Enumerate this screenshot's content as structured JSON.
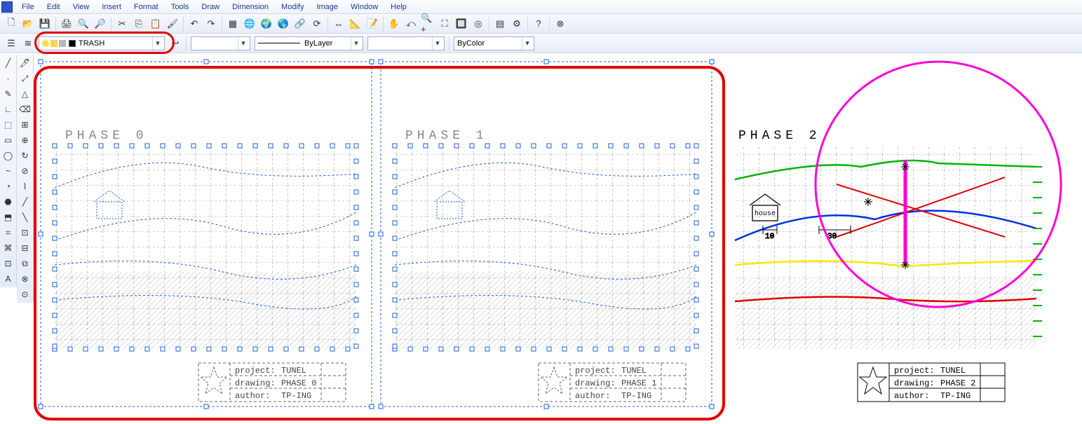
{
  "menubar": {
    "items": [
      "File",
      "Edit",
      "View",
      "Insert",
      "Format",
      "Tools",
      "Draw",
      "Dimension",
      "Modify",
      "Image",
      "Window",
      "Help"
    ]
  },
  "toolbar1": {
    "buttons": [
      {
        "name": "new-icon",
        "glyph": "🗋"
      },
      {
        "name": "open-icon",
        "glyph": "📂"
      },
      {
        "name": "save-icon",
        "glyph": "💾"
      },
      {
        "name": "sep"
      },
      {
        "name": "print-icon",
        "glyph": "🖨"
      },
      {
        "name": "print-preview-icon",
        "glyph": "🔍"
      },
      {
        "name": "find-icon",
        "glyph": "🔎"
      },
      {
        "name": "sep"
      },
      {
        "name": "cut-icon",
        "glyph": "✂"
      },
      {
        "name": "copy-icon",
        "glyph": "⎘"
      },
      {
        "name": "paste-icon",
        "glyph": "📋"
      },
      {
        "name": "match-props-icon",
        "glyph": "🖌"
      },
      {
        "name": "sep"
      },
      {
        "name": "undo-icon",
        "glyph": "↶"
      },
      {
        "name": "redo-icon",
        "glyph": "↷"
      },
      {
        "name": "sep"
      },
      {
        "name": "grid-icon",
        "glyph": "▦"
      },
      {
        "name": "web-icon",
        "glyph": "🌐"
      },
      {
        "name": "world-icon",
        "glyph": "🌍"
      },
      {
        "name": "globe2-icon",
        "glyph": "🌎"
      },
      {
        "name": "link-icon",
        "glyph": "🔗"
      },
      {
        "name": "refresh-icon",
        "glyph": "⟳"
      },
      {
        "name": "sep"
      },
      {
        "name": "dim-icon",
        "glyph": "↔"
      },
      {
        "name": "measure-icon",
        "glyph": "📐"
      },
      {
        "name": "note-icon",
        "glyph": "📝"
      },
      {
        "name": "sep"
      },
      {
        "name": "pan-icon",
        "glyph": "✋"
      },
      {
        "name": "zoom-prev-icon",
        "glyph": "⤺"
      },
      {
        "name": "zoom-in-icon",
        "glyph": "🔍+"
      },
      {
        "name": "zoom-ext-icon",
        "glyph": "⛶"
      },
      {
        "name": "zoom-win-icon",
        "glyph": "🔲"
      },
      {
        "name": "zoom-all-icon",
        "glyph": "◎"
      },
      {
        "name": "sep"
      },
      {
        "name": "table-icon",
        "glyph": "▤"
      },
      {
        "name": "props-icon",
        "glyph": "⚙"
      },
      {
        "name": "sep"
      },
      {
        "name": "help-icon",
        "glyph": "?"
      },
      {
        "name": "sep"
      },
      {
        "name": "close-icon",
        "glyph": "⊗"
      }
    ]
  },
  "toolbar2": {
    "layer_combo": {
      "value": "TRASH"
    },
    "color_combo": {
      "value": ""
    },
    "linetype_combo": {
      "value": "ByLayer"
    },
    "lineweight_combo": {
      "value": ""
    },
    "plotstyle_combo": {
      "value": "ByColor"
    }
  },
  "left_tools1": [
    "╱",
    "·",
    "✎",
    "∟",
    "⬚",
    "▭",
    "◯",
    "~",
    "◔",
    "⬣",
    "⬒",
    "⌗",
    "⌘",
    "⊡",
    "A"
  ],
  "left_tools2": [
    "🖊",
    "⤢",
    "△",
    "⌫",
    "⊞",
    "⊕",
    "↻",
    "⊘",
    "⌇",
    "╱",
    "╲",
    "⊡",
    "⊟",
    "⧉",
    "⊗",
    "⊙"
  ],
  "phases": {
    "p0": {
      "label": "PHASE 0",
      "title_project": "project:",
      "title_project_v": "TUNEL",
      "title_drawing": "drawing:",
      "title_drawing_v": "PHASE 0",
      "title_author": "author:",
      "title_author_v": "TP-ING"
    },
    "p1": {
      "label": "PHASE 1",
      "title_project": "project:",
      "title_project_v": "TUNEL",
      "title_drawing": "drawing:",
      "title_drawing_v": "PHASE 1",
      "title_author": "author:",
      "title_author_v": "TP-ING"
    },
    "p2": {
      "label": "PHASE 2",
      "title_project": "project:",
      "title_project_v": "TUNEL",
      "title_drawing": "drawing:",
      "title_drawing_v": "PHASE 2",
      "title_author": "author:",
      "title_author_v": "TP-ING"
    }
  },
  "dims": {
    "d1": "10",
    "d2": "30"
  },
  "house_label": "house"
}
